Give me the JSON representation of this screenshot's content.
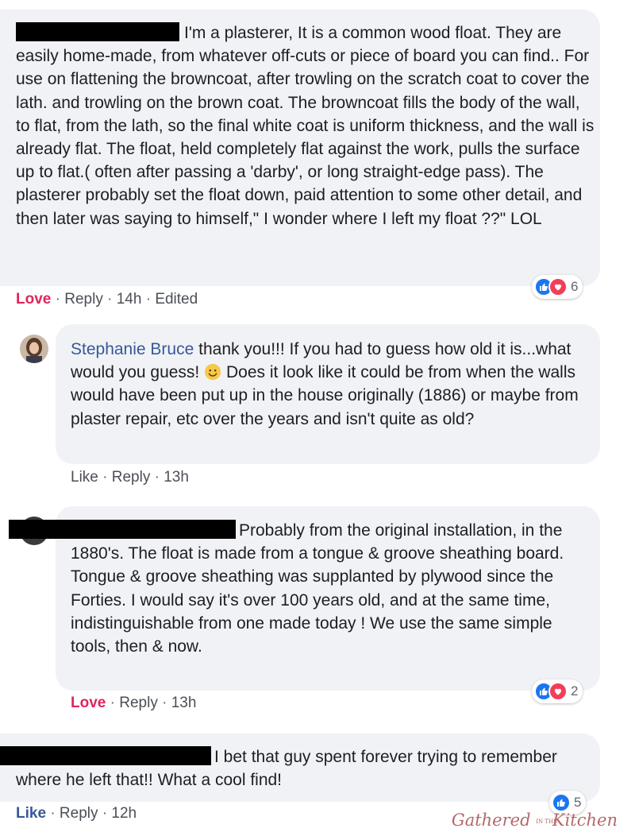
{
  "comments": [
    {
      "text": "I'm a plasterer, It is a common wood float. They are easily home-made, from whatever off-cuts or piece of board you can find.. For use on flattening the browncoat, after trowling on the scratch coat to cover the lath. and trowling on the brown coat. The browncoat fills the body of the wall, to flat, from the lath, so the final white coat is uniform thickness, and the wall is already flat. The float, held completely flat against the work, pulls the surface up to flat.( often after passing a 'darby', or long straight-edge pass). The plasterer probably set the float down, paid attention to some other detail, and then later was saying to himself,\" I wonder where I left my float ??\" LOL",
      "actions": {
        "react_label": "Love",
        "reply_label": "Reply",
        "time": "14h",
        "edited": "Edited"
      },
      "reactions": {
        "types": [
          "like",
          "love"
        ],
        "count": "6"
      }
    },
    {
      "author": "Stephanie Bruce",
      "text_before_emoji": "thank you!!! If you had to guess how old it is...what would you guess!",
      "text_after_emoji": "Does it look like it could be from when the walls would have been put up in the house originally (1886) or maybe from plaster repair, etc over the years and isn't quite as old?",
      "emoji": "smiley",
      "actions": {
        "react_label": "Like",
        "reply_label": "Reply",
        "time": "13h"
      }
    },
    {
      "text": "Probably from the original installation, in the 1880's. The float is made from a tongue & groove sheathing board. Tongue & groove sheathing was supplanted by plywood since the Forties. I would say it's over 100 years old, and at the same time, indistinguishable from one made today ! We use the same simple tools, then & now.",
      "actions": {
        "react_label": "Love",
        "reply_label": "Reply",
        "time": "13h"
      },
      "reactions": {
        "types": [
          "like",
          "love"
        ],
        "count": "2"
      }
    },
    {
      "text": "I bet that guy spent forever trying to remember where he left that!! What a cool find!",
      "actions": {
        "react_label": "Like",
        "reply_label": "Reply",
        "time": "12h"
      },
      "reactions": {
        "types": [
          "like"
        ],
        "count": "5"
      }
    }
  ],
  "separator": "·",
  "watermark": {
    "word1": "Gathered",
    "small": "IN THE",
    "word2": "Kitchen"
  },
  "colors": {
    "bubble": "#f0f2f5",
    "link": "#385898",
    "love": "#e0245e",
    "like_icon": "#1877f2",
    "love_icon": "#f33e58",
    "watermark": "#b5676b"
  }
}
